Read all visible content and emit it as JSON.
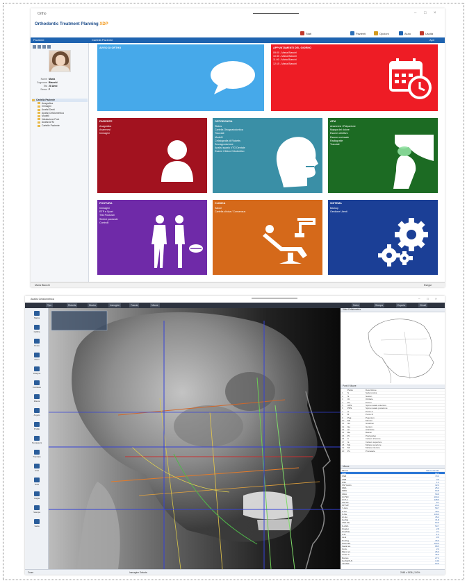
{
  "window1": {
    "title": "Ortho",
    "brand_name": "Orthodontic Treatment Planning",
    "brand_version": "XDP",
    "top_buttons": [
      {
        "label": "Stati",
        "icon": "mail-icon",
        "color": "#c0392b"
      },
      {
        "label": "Pazienti",
        "icon": "users-icon",
        "color": "#2c6fb7"
      },
      {
        "label": "Opzioni",
        "icon": "gear-icon",
        "color": "#d49a1e"
      },
      {
        "label": "Aiuto",
        "icon": "help-icon",
        "color": "#1e63b0"
      },
      {
        "label": "Uscita",
        "icon": "exit-icon",
        "color": "#c0392b"
      }
    ],
    "bar_left": "Paziente",
    "bar_mid": "Cartella Paziente",
    "bar_right": "Apri",
    "patient": {
      "fields": [
        {
          "key": "Nome",
          "value": "Maria"
        },
        {
          "key": "Cognome",
          "value": "Bianchi"
        },
        {
          "key": "Età",
          "value": "28 Anni"
        },
        {
          "key": "Sesso",
          "value": "F"
        }
      ]
    },
    "tree": {
      "root": "Cartella Paziente",
      "children": [
        "Anagrafica",
        "Immagini",
        "Analisi Denti",
        "Analisi Cefalometrica",
        "Modelli",
        "Valutazione Post",
        "Analisi ATM",
        "Cartelle Paziente"
      ]
    },
    "tiles": [
      {
        "title": "Avvio di Ortho",
        "items": [],
        "color": "#46a9ea",
        "icon": "speech-bubble-icon"
      },
      {
        "title": "Appuntamenti del giorno",
        "items": [
          "09:00 - Maria Bianchi",
          "10:30 - Maria Bianchi",
          "11:00 - Maria Bianchi",
          "12:15 - Maria Bianchi"
        ],
        "color": "#ee1c25",
        "icon": "calendar-clock-icon"
      },
      {
        "title": "Paziente",
        "items": [
          "Anagrafica",
          "Anamnesi",
          "Immagini"
        ],
        "color": "#a2121f",
        "icon": "person-icon"
      },
      {
        "title": "Ortodonzia",
        "items": [
          "Status",
          "Cartella Ortognatodontica",
          "Tracciati",
          "Modelli",
          "Cefalografia di Ricketts",
          "Sovrapposizione",
          "Analisi spazio VTO Dentale",
          "Esame Clinico Ortodontico"
        ],
        "color": "#3a8fa6",
        "icon": "profile-head-icon"
      },
      {
        "title": "ATM",
        "items": [
          "Anamnesi / Palpazione",
          "Mappa del dolore",
          "Esame obiettivo",
          "Esame occlusale",
          "Radiografie",
          "Tracciati"
        ],
        "color": "#1c6b23",
        "icon": "jaw-joint-icon"
      },
      {
        "title": "Postura",
        "items": [
          "Immagini",
          "RTP e Sport",
          "Test Posturali",
          "Sintesi posturale",
          "Controlli"
        ],
        "color": "#6f2aa8",
        "icon": "body-posture-icon"
      },
      {
        "title": "Clinica",
        "items": [
          "Salute",
          "Cartella clinica / Consensus"
        ],
        "color": "#d5691a",
        "icon": "dental-chair-icon"
      },
      {
        "title": "Sistema",
        "items": [
          "Backup",
          "Gestione Utenti"
        ],
        "color": "#1b3f96",
        "icon": "gears-icon"
      }
    ],
    "status_left": "Maria Bianchi",
    "status_right": "Esegui"
  },
  "window2": {
    "title": "Analisi Cefalometrica",
    "toolbar_chips": [
      "Tipo",
      "Ricketts",
      "Mostra",
      "Immagine",
      "Traccia",
      "Misure"
    ],
    "toolbar_right": [
      "Salva",
      "Stampa",
      "Esporta",
      "Chiudi"
    ],
    "left_tools": [
      "Marca",
      "Calibra",
      "Ruota",
      "Zoom",
      "Disegna",
      "Contrasto",
      "Misura",
      "Angolo",
      "Profilo",
      "Sovrapponi",
      "Tracciato",
      "Area",
      "Nota",
      "Griglia",
      "Stampa",
      "Salva"
    ],
    "panel_titles": [
      "Vista Cefalometria",
      "Punti / Misure",
      "Misure"
    ],
    "points_header": [
      "Punto",
      "Descrizione"
    ],
    "points": [
      [
        "1",
        "S",
        "Sella turcica"
      ],
      [
        "2",
        "N",
        "Nasion"
      ],
      [
        "3",
        "Or",
        "Orbitale"
      ],
      [
        "4",
        "Po",
        "Porion"
      ],
      [
        "5",
        "ANS",
        "Spina nasale anteriore"
      ],
      [
        "6",
        "PNS",
        "Spina nasale posteriore"
      ],
      [
        "7",
        "A",
        "Punto A"
      ],
      [
        "8",
        "B",
        "Punto B"
      ],
      [
        "9",
        "Pog",
        "Pogonion"
      ],
      [
        "10",
        "Me",
        "Menton"
      ],
      [
        "11",
        "Gn",
        "Gnathion"
      ],
      [
        "12",
        "Go",
        "Gonion"
      ],
      [
        "13",
        "Ar",
        "Articolare"
      ],
      [
        "14",
        "Ba",
        "Basion"
      ],
      [
        "15",
        "Pt",
        "Pterigoideo"
      ],
      [
        "16",
        "Ii",
        "Incisivo inferiore"
      ],
      [
        "17",
        "Is",
        "Incisivo superiore"
      ],
      [
        "18",
        "Ms",
        "Molare superiore"
      ],
      [
        "19",
        "Mi",
        "Molare inferiore"
      ],
      [
        "20",
        "Pn",
        "Pronasale"
      ]
    ],
    "measures_header": [
      "Misura",
      "Valore rilevato"
    ],
    "measures": [
      [
        "SNA",
        "82.5"
      ],
      [
        "SNB",
        "79.0"
      ],
      [
        "ANB",
        "3.5"
      ],
      [
        "Wits",
        "1.2"
      ],
      [
        "SN^GoGn",
        "32.0"
      ],
      [
        "FMA",
        "25.4"
      ],
      [
        "IMPA",
        "94.8"
      ],
      [
        "FMIA",
        "59.8"
      ],
      [
        "U1^SN",
        "104.2"
      ],
      [
        "U1^L1",
        "128.6"
      ],
      [
        "SN^PP",
        "8.1"
      ],
      [
        "PP^MP",
        "24.3"
      ],
      [
        "Y-Axis",
        "59.7"
      ],
      [
        "S-Go",
        "78.4"
      ],
      [
        "N-Me",
        "118.6"
      ],
      [
        "Ar-Go",
        "45.2"
      ],
      [
        "Go-Me",
        "71.8"
      ],
      [
        "ANS-Me",
        "64.9"
      ],
      [
        "N-ANS",
        "53.7"
      ],
      [
        "Overjet",
        "2.8"
      ],
      [
        "Overbite",
        "2.1"
      ],
      [
        "Li-E",
        "-1.4"
      ],
      [
        "Ls-E",
        "-3.0"
      ],
      [
        "Pn-Pog",
        "15.6"
      ],
      [
        "Naso-lab.",
        "104.0"
      ],
      [
        "Facial ax.",
        "88.5"
      ],
      [
        "Conv.",
        "2.2"
      ],
      [
        "Mand. pl.",
        "26.0"
      ],
      [
        "Lower h.",
        "46.5"
      ],
      [
        "Ramus",
        "27.4"
      ],
      [
        "Go-Me/S-N",
        "1.02"
      ],
      [
        "Jarabak",
        "64.5"
      ]
    ],
    "status_left": "Zoom",
    "status_mid": "Immagine Salvata",
    "status_right": "2048 x 1536 | 100%"
  }
}
